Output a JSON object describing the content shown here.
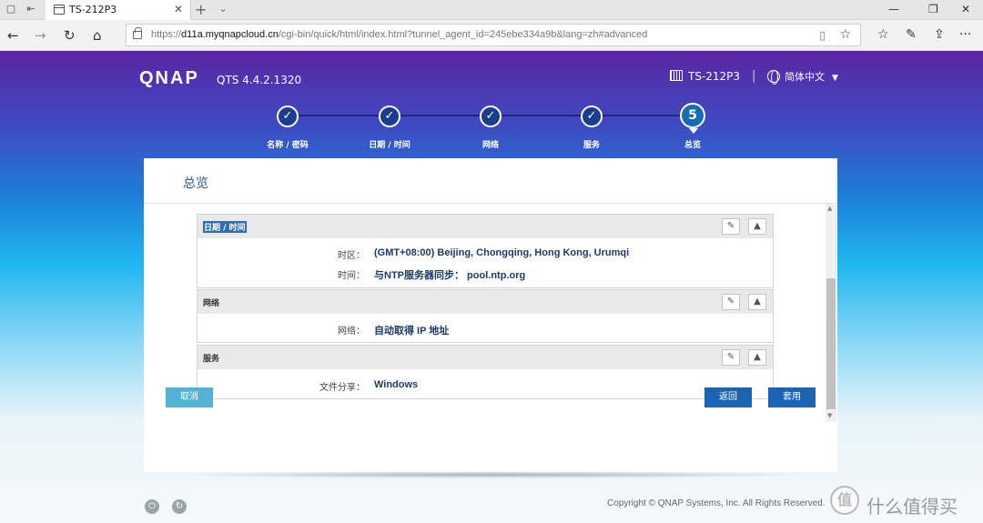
{
  "browser": {
    "tab_title": "TS-212P3",
    "tab_close": "✕",
    "new_tab": "+",
    "tab_dropdown": "⌄",
    "url_prefix": "https://",
    "url_host": "d11a.myqnapcloud.cn",
    "url_rest": "/cgi-bin/quick/html/index.html?tunnel_agent_id=245ebe334a9b&lang=zh#advanced",
    "icons": {
      "back": "←",
      "forward": "→",
      "refresh": "↻",
      "home": "⌂",
      "reading": "▯",
      "favorite": "☆",
      "hub": "☆",
      "notes": "✎",
      "share": "⇪",
      "more": "···",
      "minimize": "—",
      "restore": "❐",
      "close": "✕"
    }
  },
  "header": {
    "logo": "QNAP",
    "version": "QTS 4.4.2.1320",
    "device": "TS-212P3",
    "separator": "|",
    "language": "简体中文",
    "language_caret": "▼"
  },
  "steps": [
    {
      "mark": "✓",
      "label": "名称 / 密码"
    },
    {
      "mark": "✓",
      "label": "日期 / 时间"
    },
    {
      "mark": "✓",
      "label": "网络"
    },
    {
      "mark": "✓",
      "label": "服务"
    },
    {
      "mark": "5",
      "label": "总览"
    }
  ],
  "overview": {
    "title": "总览",
    "sections": [
      {
        "name": "日期 / 时间",
        "rows": [
          {
            "label": "时区：",
            "value": "(GMT+08:00) Beijing, Chongqing, Hong Kong, Urumqi"
          },
          {
            "label": "时间：",
            "value": "与NTP服务器同步： pool.ntp.org"
          }
        ]
      },
      {
        "name": "网络",
        "rows": [
          {
            "label": "网络：",
            "value": "自动取得 IP 地址"
          }
        ]
      },
      {
        "name": "服务",
        "rows": [
          {
            "label": "文件分享：",
            "value": "Windows"
          }
        ]
      }
    ],
    "edit_icon": "✎",
    "collapse_icon": "▲"
  },
  "buttons": {
    "cancel": "取消",
    "back": "返回",
    "apply": "套用"
  },
  "footer": {
    "copyright": "Copyright © QNAP Systems, Inc. All Rights Reserved.",
    "power_icon": "⏻",
    "refresh_icon": "↻",
    "watermark_mark": "值",
    "watermark_text": "什么值得买"
  },
  "colors": {
    "accent": "#1a64b6",
    "cancel": "#4fb3d3",
    "step": "#1a3d8f"
  }
}
